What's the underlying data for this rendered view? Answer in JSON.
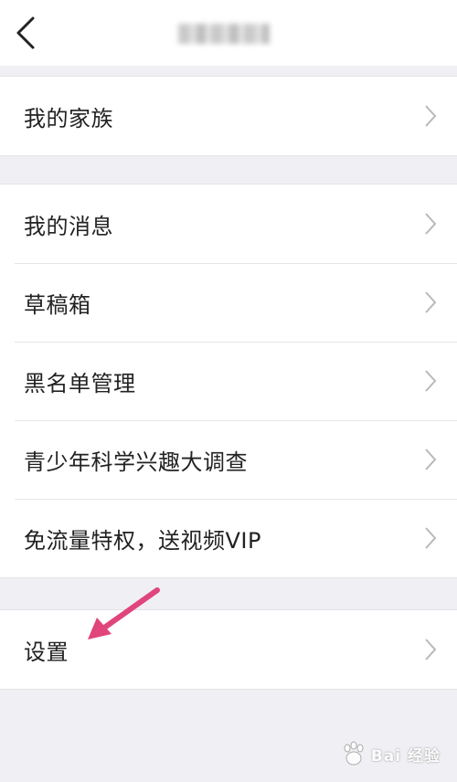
{
  "menu": {
    "group1": [
      {
        "label": "我的家族"
      }
    ],
    "group2": [
      {
        "label": "我的消息"
      },
      {
        "label": "草稿箱"
      },
      {
        "label": "黑名单管理"
      },
      {
        "label": "青少年科学兴趣大调查"
      },
      {
        "label": "免流量特权，送视频VIP"
      }
    ],
    "group3": [
      {
        "label": "设置"
      }
    ]
  },
  "annotation": {
    "arrow_color": "#e0457b"
  },
  "watermark": {
    "text": "Bai 经验"
  }
}
